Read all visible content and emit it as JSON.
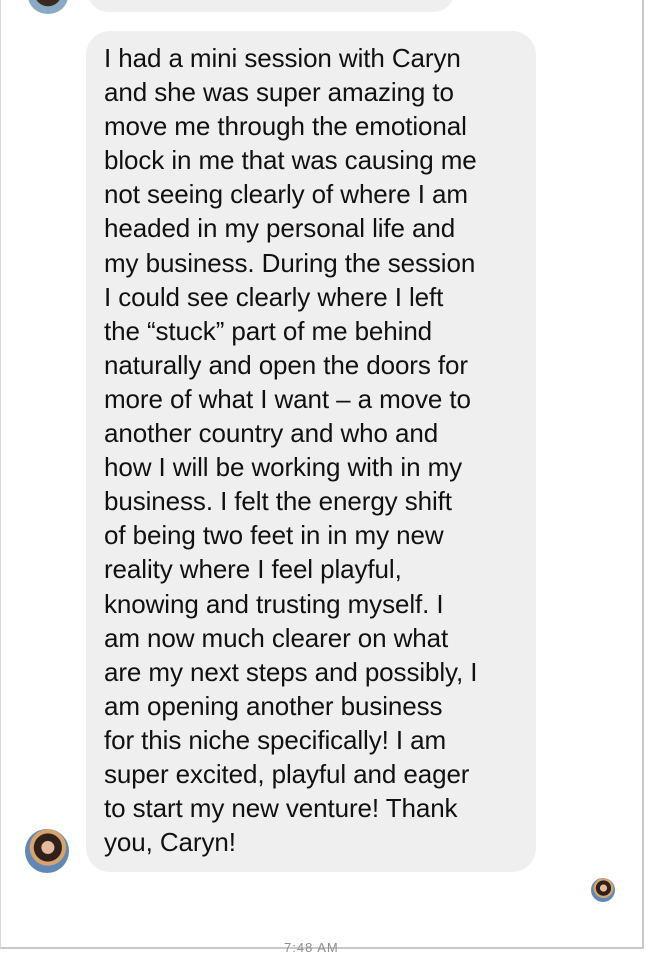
{
  "chat": {
    "message": {
      "lines": [
        "I had a mini session with Caryn",
        "and she was super amazing to",
        "move me through the emotional",
        "block in me that was causing me",
        "not seeing clearly of where I am",
        "headed in my personal life and",
        "my business. During the session",
        "I could see clearly where I left",
        "the “stuck” part of me behind",
        "naturally and open the doors for",
        "more of what I want – a move to",
        "another country and who and",
        "how I will be working with in my",
        "business. I felt the energy shift",
        "of being two feet in in my new",
        "reality where I feel playful,",
        "knowing and trusting myself. I",
        "am now much clearer on what",
        "are my next steps and possibly, I",
        "am opening another business",
        "for this niche specifically! I am",
        "super excited, playful and eager",
        "to start my new venture! Thank",
        "you, Caryn!"
      ]
    },
    "timestamp": "7:48 AM",
    "avatars": {
      "sender_icon": "user-avatar-icon",
      "read_receipt_icon": "read-receipt-avatar-icon"
    }
  },
  "colors": {
    "bubble": "#efefef",
    "text": "#111111",
    "background": "#ffffff"
  }
}
